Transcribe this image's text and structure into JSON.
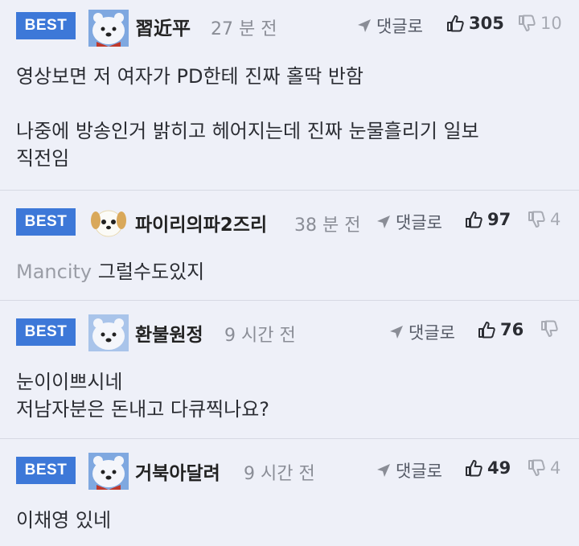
{
  "colors": {
    "badge": "#3d78d8",
    "background": "#eef0f8",
    "divider": "#d6d9e3"
  },
  "reply_label": "댓글로",
  "comments": [
    {
      "badge": "BEST",
      "avatar_icon": "polar-bear-avatar-icon",
      "nickname": "習近平",
      "time": "27 분 전",
      "likes": "305",
      "dislikes": "10",
      "lines": [
        "영상보면 저 여자가 PD한테 진짜 홀딱 반함",
        "",
        "나중에 방송인거 밝히고 헤어지는데 진짜 눈물흘리기 일보",
        "직전임"
      ]
    },
    {
      "badge": "BEST",
      "avatar_icon": "puppy-avatar-icon",
      "nickname": "파이리의파2즈리",
      "time": "38 분 전",
      "likes": "97",
      "dislikes": "4",
      "prefix": "Mancity",
      "lines": [
        "그럴수도있지"
      ]
    },
    {
      "badge": "BEST",
      "avatar_icon": "polar-bear-avatar-icon",
      "nickname": "환불원정",
      "time": "9 시간 전",
      "likes": "76",
      "dislikes": "",
      "lines": [
        "눈이이쁘시네",
        "저남자분은 돈내고 다큐찍나요?"
      ]
    },
    {
      "badge": "BEST",
      "avatar_icon": "polar-bear-avatar-icon",
      "nickname": "거북아달려",
      "time": "9 시간 전",
      "likes": "49",
      "dislikes": "4",
      "lines": [
        "이채영 있네"
      ]
    }
  ]
}
